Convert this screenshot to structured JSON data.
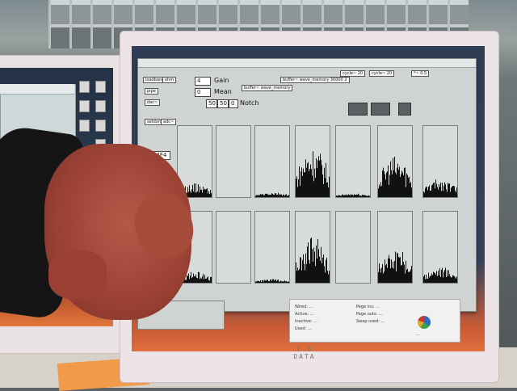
{
  "patcher": {
    "gain_label": "Gain",
    "gain_value": "4",
    "mean_label": "Mean",
    "mean_value": "0",
    "notch_label": "Notch",
    "notch_values": [
      "50",
      "50",
      "0"
    ],
    "display_value": "8444F4",
    "objects": [
      "loadbang",
      "ohm",
      "pipe",
      "dac~",
      "setdomain",
      "adc~",
      "buffer~ wave_memory",
      "buffer~ wave_memory 30000 2",
      "cycle~ 20",
      "cycle~ 20",
      "*~ 0.5"
    ]
  },
  "spectra": {
    "top_row_fill": [
      0.15,
      0.0,
      0.05,
      0.55,
      0.04,
      0.45,
      0.2
    ],
    "bottom_row_fill": [
      0.12,
      0.0,
      0.04,
      0.5,
      0.0,
      0.4,
      0.18
    ]
  },
  "system_panel": {
    "rows_left": [
      "Wired: ...",
      "Active: ...",
      "Inactive: ...",
      "Used: ..."
    ],
    "rows_right": [
      "Page ins: ...",
      "Page outs: ...",
      "Swap used: ..."
    ],
    "pie_caption": "..."
  },
  "brand": "I-O DATA",
  "sticky_note_text": ""
}
